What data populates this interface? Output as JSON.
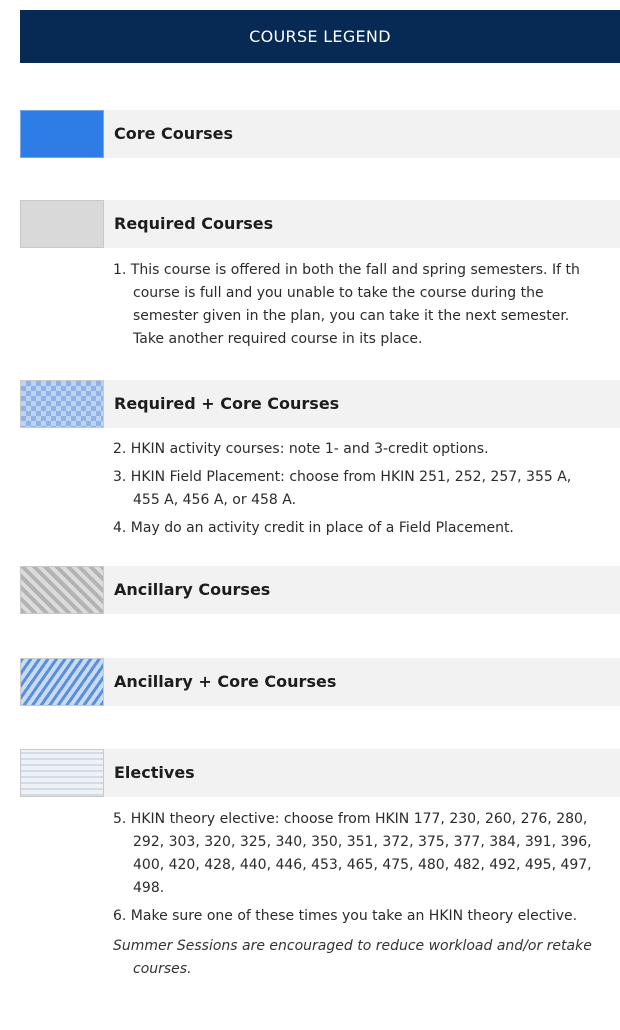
{
  "header": {
    "title": "COURSE LEGEND"
  },
  "legend": {
    "core": {
      "label": "Core Courses"
    },
    "required": {
      "label": "Required Courses",
      "notes": [
        "1. This course is offered in both the fall and spring semesters. If th course is full and you unable to take the course during the semester given in the plan, you can take it the next semester. Take another required course in its place."
      ]
    },
    "required_core": {
      "label": "Required + Core Courses",
      "notes": [
        "2. HKIN activity courses: note 1- and 3-credit options.",
        "3. HKIN Field Placement: choose from HKIN 251, 252, 257, 355 A, 455 A, 456 A, or 458 A.",
        "4.  May do an activity credit in place of a Field Placement."
      ]
    },
    "ancillary": {
      "label": "Ancillary Courses"
    },
    "ancillary_core": {
      "label": "Ancillary + Core Courses"
    },
    "electives": {
      "label": "Electives",
      "notes": [
        "5. HKIN theory elective: choose from HKIN 177, 230, 260, 276, 280, 292, 303, 320, 325, 340, 350, 351, 372, 375, 377, 384, 391, 396, 400, 420, 428, 440, 446, 453, 465, 475, 480, 482, 492, 495, 497, 498.",
        "6. Make sure one of these times you take an HKIN theory elective."
      ]
    }
  },
  "footer": {
    "summer_note": "Summer Sessions are encouraged to reduce workload and/or retake courses."
  },
  "colors": {
    "header_bg": "#062a54",
    "core_blue": "#2e7de6",
    "required_gray": "#d9d9d9"
  }
}
